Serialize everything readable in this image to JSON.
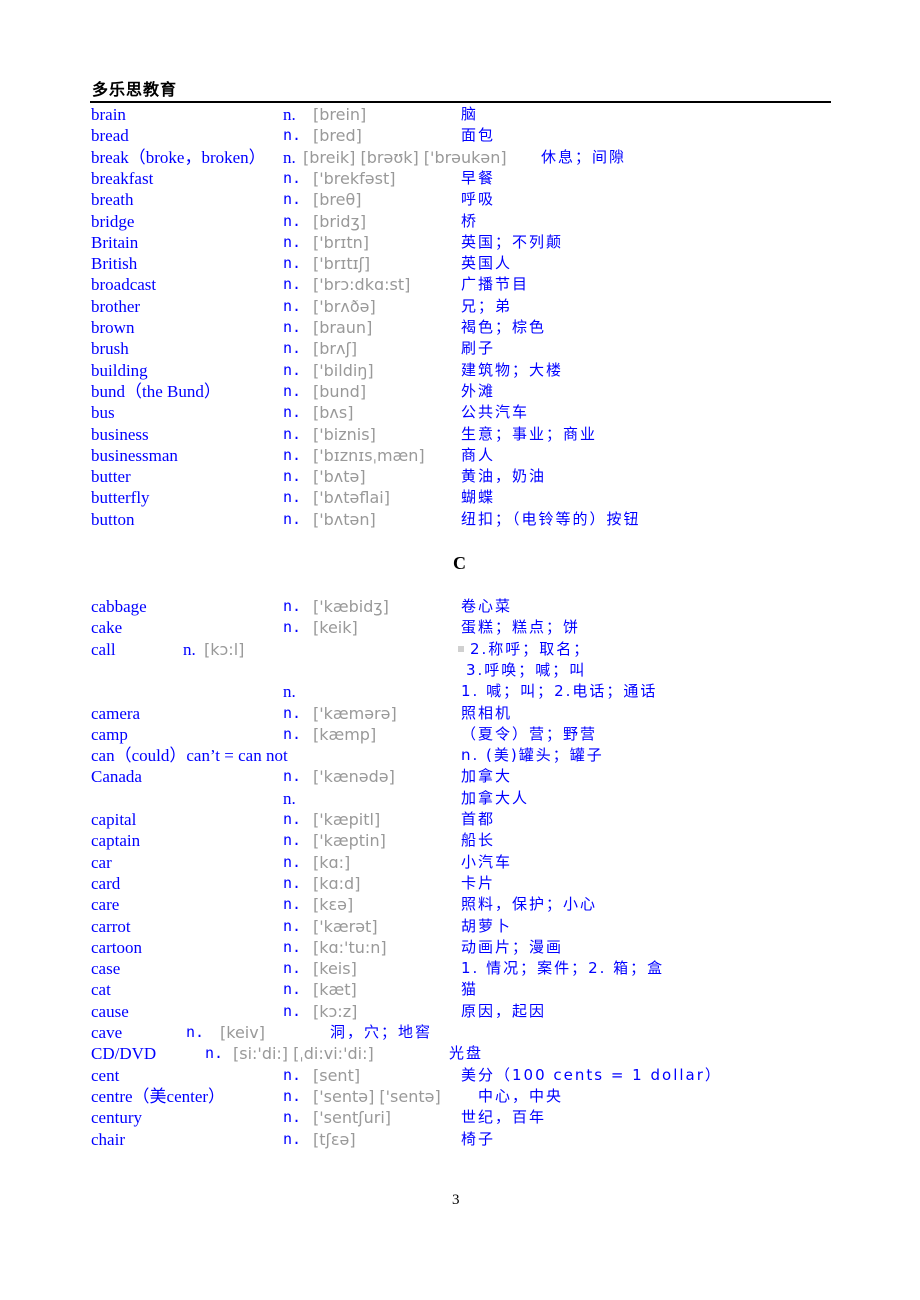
{
  "header": {
    "title": "多乐思教育"
  },
  "section_b": {
    "entries": [
      {
        "word": "brain",
        "pos": "n.",
        "phonetic": "[brein]",
        "meaning": "脑"
      },
      {
        "word": "bread",
        "pos": "n.",
        "phonetic": "[bred]",
        "meaning": "面包"
      },
      {
        "word": "break（broke，broken）",
        "pos": "n.",
        "phonetic": "[breik] [brəʊk] ['brəukən]",
        "meaning": "休息；间隙"
      },
      {
        "word": "breakfast",
        "pos": "n.",
        "phonetic": "['brekfəst]",
        "meaning": "早餐"
      },
      {
        "word": "breath",
        "pos": "n.",
        "phonetic": "[breθ]",
        "meaning": "呼吸"
      },
      {
        "word": "bridge",
        "pos": "n.",
        "phonetic": "[bridʒ]",
        "meaning": "桥"
      },
      {
        "word": "Britain",
        "pos": "n.",
        "phonetic": "['brɪtn]",
        "meaning": "英国；不列颠"
      },
      {
        "word": "British",
        "pos": "n.",
        "phonetic": "['brɪtɪʃ]",
        "meaning": "英国人"
      },
      {
        "word": "broadcast",
        "pos": "n.",
        "phonetic": "['brɔ:dkɑ:st]",
        "meaning": "广播节目"
      },
      {
        "word": "brother",
        "pos": "n.",
        "phonetic": "['brʌðə]",
        "meaning": "兄；弟"
      },
      {
        "word": "brown",
        "pos": "n.",
        "phonetic": "[braun]",
        "meaning": "褐色；棕色"
      },
      {
        "word": "brush",
        "pos": "n.",
        "phonetic": "[brʌʃ]",
        "meaning": "刷子"
      },
      {
        "word": "building",
        "pos": "n.",
        "phonetic": "['bildiŋ]",
        "meaning": "建筑物；大楼"
      },
      {
        "word": "bund（the Bund）",
        "pos": "n.",
        "phonetic": "[bund]",
        "meaning": "外滩"
      },
      {
        "word": "bus",
        "pos": "n.",
        "phonetic": "[bʌs]",
        "meaning": "公共汽车"
      },
      {
        "word": "business",
        "pos": "n.",
        "phonetic": "['biznis]",
        "meaning": "生意；事业；商业"
      },
      {
        "word": "businessman",
        "pos": "n.",
        "phonetic": "['bɪznɪsˌmæn]",
        "meaning": "商人"
      },
      {
        "word": "butter",
        "pos": "n.",
        "phonetic": "['bʌtə]",
        "meaning": "黄油，奶油"
      },
      {
        "word": "butterfly",
        "pos": "n.",
        "phonetic": "['bʌtəflai]",
        "meaning": "蝴蝶"
      },
      {
        "word": "button",
        "pos": "n.",
        "phonetic": "['bʌtən]",
        "meaning": "纽扣；（电铃等的）按钮"
      }
    ]
  },
  "section_c": {
    "letter": "C",
    "entries": [
      {
        "word": "cabbage",
        "pos": "n.",
        "phonetic": "['kæbidʒ]",
        "meaning": "卷心菜"
      },
      {
        "word": "cake",
        "pos": "n.",
        "phonetic": "[keik]",
        "meaning": "蛋糕；糕点；饼"
      },
      {
        "word": "call",
        "pos": "n.",
        "phonetic": "[kɔ:l]",
        "meaning": "2.称呼；取名；"
      },
      {
        "word": "",
        "pos": "",
        "phonetic": "",
        "meaning": "3.呼唤；喊；叫"
      },
      {
        "word": "",
        "pos": "n.",
        "phonetic": "",
        "meaning": "1. 喊；叫；2.电话；通话"
      },
      {
        "word": "camera",
        "pos": "n.",
        "phonetic": "['kæmərə]",
        "meaning": "照相机"
      },
      {
        "word": "camp",
        "pos": "n.",
        "phonetic": "[kæmp]",
        "meaning": "（夏令）营；野营"
      },
      {
        "word": "can（could）can’t = can not",
        "pos": "",
        "phonetic": "",
        "meaning": "n. (美)罐头；罐子"
      },
      {
        "word": "Canada",
        "pos": "n.",
        "phonetic": "['kænədə]",
        "meaning": "加拿大"
      },
      {
        "word": "",
        "pos": "n.",
        "phonetic": "",
        "meaning": "加拿大人"
      },
      {
        "word": "capital",
        "pos": "n.",
        "phonetic": "['kæpitl]",
        "meaning": "首都"
      },
      {
        "word": "captain",
        "pos": "n.",
        "phonetic": "['kæptin]",
        "meaning": "船长"
      },
      {
        "word": "car",
        "pos": "n.",
        "phonetic": "[kɑ:]",
        "meaning": "小汽车"
      },
      {
        "word": "card",
        "pos": "n.",
        "phonetic": "[kɑ:d]",
        "meaning": "卡片"
      },
      {
        "word": "care",
        "pos": "n.",
        "phonetic": "[kɛə]",
        "meaning": "照料，保护；小心"
      },
      {
        "word": "carrot",
        "pos": "n.",
        "phonetic": "['kærət]",
        "meaning": "胡萝卜"
      },
      {
        "word": "cartoon",
        "pos": "n.",
        "phonetic": "[kɑ:'tu:n]",
        "meaning": "动画片；漫画"
      },
      {
        "word": "case",
        "pos": "n.",
        "phonetic": "[keis]",
        "meaning": "1. 情况；案件；2. 箱；盒"
      },
      {
        "word": "cat",
        "pos": "n.",
        "phonetic": "[kæt]",
        "meaning": "猫"
      },
      {
        "word": "cause",
        "pos": "n.",
        "phonetic": "[kɔ:z]",
        "meaning": "原因，起因"
      },
      {
        "word": "cave",
        "pos": "n.",
        "phonetic": "[keiv]",
        "meaning": "洞，穴；地窖"
      },
      {
        "word": "CD/DVD",
        "pos": "n.",
        "phonetic": "[si:'di:] [ˌdi:vi:'di:]",
        "meaning": "光盘"
      },
      {
        "word": "cent",
        "pos": "n.",
        "phonetic": "[sent]",
        "meaning": "美分（100 cents = 1 dollar）"
      },
      {
        "word": "centre（美center）",
        "pos": "n.",
        "phonetic": "['sentə]  ['sentə]",
        "meaning": "中心，中央"
      },
      {
        "word": "century",
        "pos": "n.",
        "phonetic": "['sentʃuri]",
        "meaning": "世纪，百年"
      },
      {
        "word": "chair",
        "pos": "n.",
        "phonetic": "[tʃɛə]",
        "meaning": "椅子"
      }
    ]
  },
  "footer": {
    "page_number": "3"
  }
}
